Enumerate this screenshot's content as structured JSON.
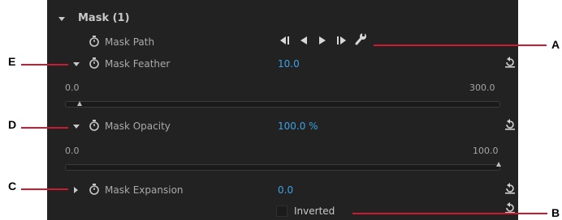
{
  "mask": {
    "title": "Mask (1)",
    "path_label": "Mask Path",
    "feather": {
      "label": "Mask Feather",
      "value": "10.0",
      "min": "0.0",
      "max": "300.0",
      "level": 0.033
    },
    "opacity": {
      "label": "Mask Opacity",
      "value": "100.0 %",
      "min": "0.0",
      "max": "100.0",
      "level": 1.0
    },
    "expansion": {
      "label": "Mask Expansion",
      "value": "0.0"
    },
    "inverted_label": "Inverted"
  },
  "callouts": {
    "a": "A",
    "b": "B",
    "c": "C",
    "d": "D",
    "e": "E"
  },
  "colors": {
    "panel_bg": "#222222",
    "value_blue": "#3aa3e8",
    "callout_red": "#cc1a33"
  }
}
